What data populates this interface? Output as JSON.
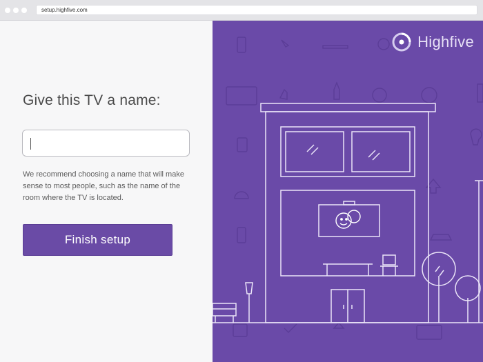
{
  "browser": {
    "url": "setup.highfive.com"
  },
  "setup": {
    "heading": "Give this TV a name:",
    "name_value": "",
    "helper_text": "We recommend choosing a name that will make sense to most people, such as the name of the room where the TV is located.",
    "finish_label": "Finish setup"
  },
  "brand": {
    "name": "Highfive"
  },
  "colors": {
    "accent": "#6a4ba6",
    "illustration_bg": "#6a4aa8",
    "line_art": "#e9e3f7"
  },
  "icons": [
    "close-dot-icon",
    "minimize-dot-icon",
    "maximize-dot-icon",
    "highfive-logo-icon",
    "chat-bubbles-icon"
  ]
}
